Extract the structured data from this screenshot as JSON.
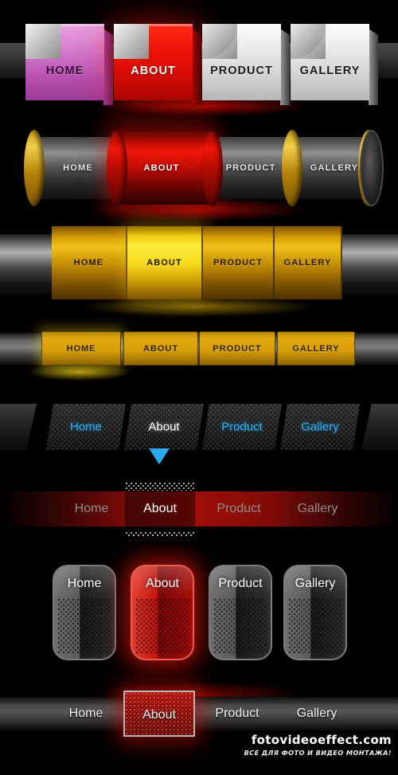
{
  "meta": {
    "title": "Web Navigation Menu Buttons Collection",
    "background": "#000000"
  },
  "labels": {
    "home": "HOME",
    "about": "ABOUT",
    "product": "PRODUCT",
    "gallery": "GALLERY",
    "home_mixed": "Home",
    "about_mixed": "About",
    "product_mixed": "Product",
    "gallery_mixed": "Gallery"
  },
  "colors": {
    "purple": "#b44fae",
    "red": "#ec1006",
    "silver": "#e6e6e6",
    "gold": "#e0a80c",
    "bright_yellow": "#ffe63a",
    "blue_text": "#2fb1f2",
    "dark_red_bar": "#9e0d08",
    "black": "#000000"
  },
  "menus": [
    {
      "id": "row1",
      "style": "3d-folded-tabs",
      "active": "ABOUT",
      "items": [
        {
          "label": "HOME",
          "color": "#b44fae",
          "state": "normal"
        },
        {
          "label": "ABOUT",
          "color": "#ec1006",
          "state": "active"
        },
        {
          "label": "PRODUCT",
          "color": "#e6e6e6",
          "state": "normal"
        },
        {
          "label": "GALLERY",
          "color": "#e6e6e6",
          "state": "normal"
        }
      ]
    },
    {
      "id": "row2",
      "style": "dark-cylinder-gold-rings",
      "active": "ABOUT",
      "items": [
        {
          "label": "HOME",
          "state": "normal"
        },
        {
          "label": "ABOUT",
          "state": "active"
        },
        {
          "label": "PRODUCT",
          "state": "normal"
        },
        {
          "label": "GALLERY",
          "state": "normal"
        }
      ]
    },
    {
      "id": "row3",
      "style": "gold-barrel",
      "active": "ABOUT",
      "items": [
        {
          "label": "HOME",
          "state": "normal"
        },
        {
          "label": "ABOUT",
          "state": "active"
        },
        {
          "label": "PRODUCT",
          "state": "normal"
        },
        {
          "label": "GALLERY",
          "state": "normal"
        }
      ]
    },
    {
      "id": "row4",
      "style": "flat-gold-tabs",
      "active": "HOME",
      "items": [
        {
          "label": "HOME",
          "state": "active"
        },
        {
          "label": "ABOUT",
          "state": "normal"
        },
        {
          "label": "PRODUCT",
          "state": "normal"
        },
        {
          "label": "GALLERY",
          "state": "normal"
        }
      ]
    },
    {
      "id": "row5",
      "style": "blue-honeycomb-trapezoid",
      "active": "About",
      "indicator": "triangle-down",
      "items": [
        {
          "label": "Home",
          "state": "normal"
        },
        {
          "label": "About",
          "state": "active"
        },
        {
          "label": "Product",
          "state": "normal"
        },
        {
          "label": "Gallery",
          "state": "normal"
        }
      ]
    },
    {
      "id": "row6",
      "style": "dark-red-fade-bar",
      "active": "About",
      "items": [
        {
          "label": "Home",
          "state": "normal"
        },
        {
          "label": "About",
          "state": "active"
        },
        {
          "label": "Product",
          "state": "normal"
        },
        {
          "label": "Gallery",
          "state": "normal"
        }
      ]
    },
    {
      "id": "row7",
      "style": "rounded-honeycomb-buttons",
      "active": "About",
      "items": [
        {
          "label": "Home",
          "state": "normal"
        },
        {
          "label": "About",
          "state": "active"
        },
        {
          "label": "Product",
          "state": "normal"
        },
        {
          "label": "Gallery",
          "state": "normal"
        }
      ]
    },
    {
      "id": "row8",
      "style": "gray-bar-red-tab",
      "active": "About",
      "items": [
        {
          "label": "Home",
          "state": "normal"
        },
        {
          "label": "About",
          "state": "active"
        },
        {
          "label": "Product",
          "state": "normal"
        },
        {
          "label": "Gallery",
          "state": "normal"
        }
      ]
    }
  ],
  "watermark": {
    "site": "fotovideoeffect.com",
    "tagline": "ВСЕ ДЛЯ ФОТО И ВИДЕО МОНТАЖА!"
  }
}
